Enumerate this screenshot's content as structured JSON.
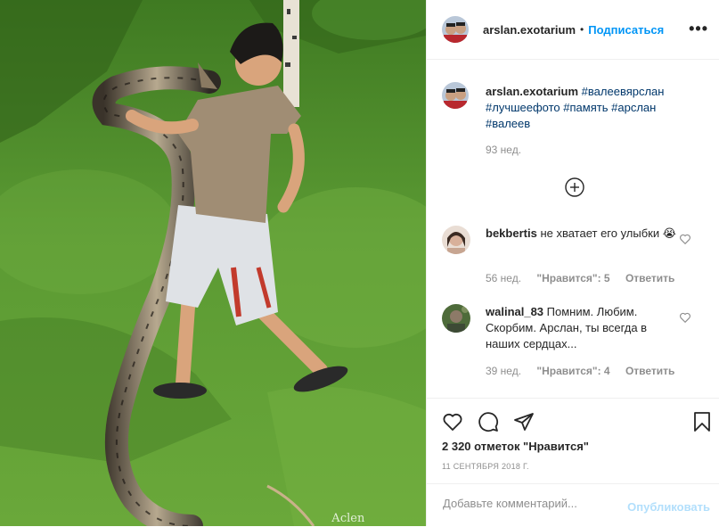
{
  "post": {
    "image_alt": "Man walking on grass carrying a large snake",
    "watermark": "Асlen",
    "author": {
      "username": "arslan.exotarium",
      "separator": "•",
      "follow_label": "Подписаться",
      "more_label": "•••"
    },
    "caption": {
      "username": "arslan.exotarium",
      "hashtags": [
        "#валеевярслан",
        "#лучшеефото",
        "#память",
        "#арслан",
        "#валеев"
      ],
      "time": "93 нед."
    },
    "comments": [
      {
        "username": "bekbertis",
        "text": "не хватает его улыбки 😭",
        "time": "56 нед.",
        "likes": "\"Нравится\": 5",
        "reply": "Ответить"
      },
      {
        "username": "walinal_83",
        "text": "Помним. Любим. Скорбим. Арслан, ты всегда в наших сердцах...",
        "time": "39 нед.",
        "likes": "\"Нравится\": 4",
        "reply": "Ответить"
      }
    ],
    "likes_text": "2 320 отметок \"Нравится\"",
    "date": "11 СЕНТЯБРЯ 2018 Г.",
    "add_comment_placeholder": "Добавьте комментарий...",
    "post_button": "Опубликовать"
  },
  "icons": {
    "load_more": "plus-circle-icon",
    "comment_like": "heart-outline-icon",
    "like": "heart-outline-icon",
    "comment": "speech-bubble-icon",
    "share": "paper-plane-icon",
    "save": "bookmark-icon"
  },
  "colors": {
    "link_blue": "#0095f6",
    "hashtag": "#00376b",
    "muted": "#8e8e8e",
    "post_disabled": "#b2dffc",
    "border": "#efefef"
  }
}
